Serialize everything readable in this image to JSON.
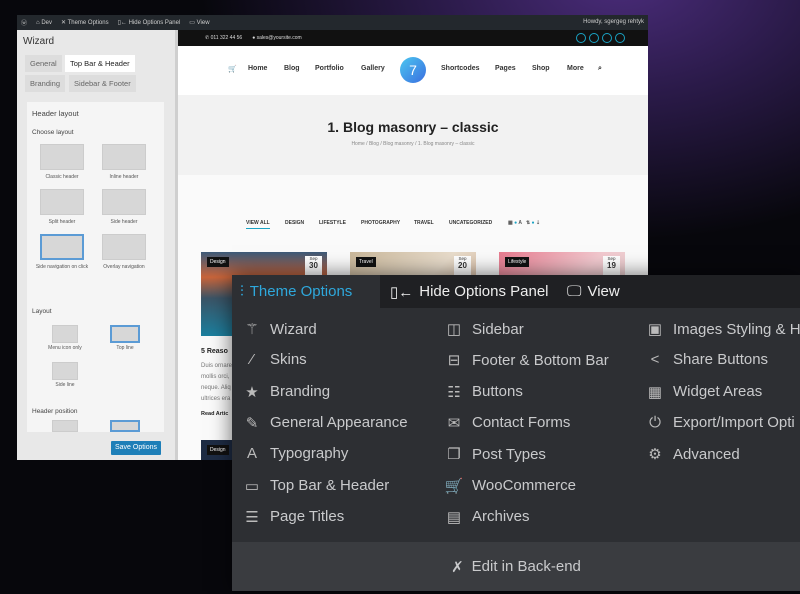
{
  "adminbar": {
    "site": "Dev",
    "theme_options": "Theme Options",
    "hide_panel": "Hide Options Panel",
    "view": "View",
    "howdy": "Howdy, sgergeg rehtyk"
  },
  "panel": {
    "title": "Wizard",
    "tabs": [
      "General",
      "Top Bar & Header",
      "Branding",
      "Sidebar & Footer"
    ],
    "active_tab": "Top Bar & Header",
    "header_layout": "Header layout",
    "choose_layout": "Choose layout",
    "layouts": [
      "Classic header",
      "Inline header",
      "Split header",
      "Side header",
      "Side navigation on click",
      "Overlay navigation"
    ],
    "selected_layout": "Side navigation on click",
    "layout_label": "Layout",
    "layout_options": [
      "Menu icon only",
      "Top line",
      "Side line"
    ],
    "selected_layout_option": "Top line",
    "header_position": "Header position",
    "save": "Save Options"
  },
  "site": {
    "phone": "011 322 44 56",
    "email": "sales@yoursite.com",
    "nav": [
      "Home",
      "Blog",
      "Portfolio",
      "Gallery",
      "Shortcodes",
      "Pages",
      "Shop",
      "More"
    ],
    "logo": "7",
    "title": "1. Blog masonry – classic",
    "breadcrumb": "Home  /  Blog  /  Blog masonry  /  1. Blog masonry – classic",
    "filters": [
      "VIEW ALL",
      "DESIGN",
      "LIFESTYLE",
      "PHOTOGRAPHY",
      "TRAVEL",
      "UNCATEGORIZED"
    ],
    "active_filter": "VIEW ALL",
    "cards": [
      {
        "category": "Design",
        "month": "Sep",
        "day": "30"
      },
      {
        "category": "Travel",
        "month": "Sep",
        "day": "20"
      },
      {
        "category": "Lifestyle",
        "month": "Sep",
        "day": "19"
      }
    ],
    "post_title": "5 Reaso",
    "excerpt": [
      "Duis ornare",
      "mollis orci,",
      "neque. Aliq",
      "ultrices era"
    ],
    "read_more": "Read Artic",
    "card4_category": "Design"
  },
  "menu": {
    "title": "Theme Options",
    "hide": "Hide Options Panel",
    "view": "View",
    "accent": "#2ea8dc",
    "columns": [
      [
        {
          "label": "Wizard",
          "icon": "wand-icon"
        },
        {
          "label": "Skins",
          "icon": "brush-icon"
        },
        {
          "label": "Branding",
          "icon": "star-icon"
        },
        {
          "label": "General Appearance",
          "icon": "pencil-ruler-icon"
        },
        {
          "label": "Typography",
          "icon": "font-icon"
        },
        {
          "label": "Top Bar & Header",
          "icon": "window-icon"
        },
        {
          "label": "Page Titles",
          "icon": "page-icon"
        }
      ],
      [
        {
          "label": "Sidebar",
          "icon": "sidebar-icon"
        },
        {
          "label": "Footer & Bottom Bar",
          "icon": "footer-icon"
        },
        {
          "label": "Buttons",
          "icon": "buttons-icon"
        },
        {
          "label": "Contact Forms",
          "icon": "envelope-icon"
        },
        {
          "label": "Post Types",
          "icon": "copy-icon"
        },
        {
          "label": "WooCommerce",
          "icon": "cart-icon"
        },
        {
          "label": "Archives",
          "icon": "archive-icon"
        }
      ],
      [
        {
          "label": "Images Styling & H",
          "icon": "image-icon"
        },
        {
          "label": "Share Buttons",
          "icon": "share-icon"
        },
        {
          "label": "Widget Areas",
          "icon": "widgets-icon"
        },
        {
          "label": "Export/Import Opti",
          "icon": "power-icon"
        },
        {
          "label": "Advanced",
          "icon": "gears-icon"
        }
      ]
    ],
    "edit_backend": "Edit in Back-end"
  }
}
